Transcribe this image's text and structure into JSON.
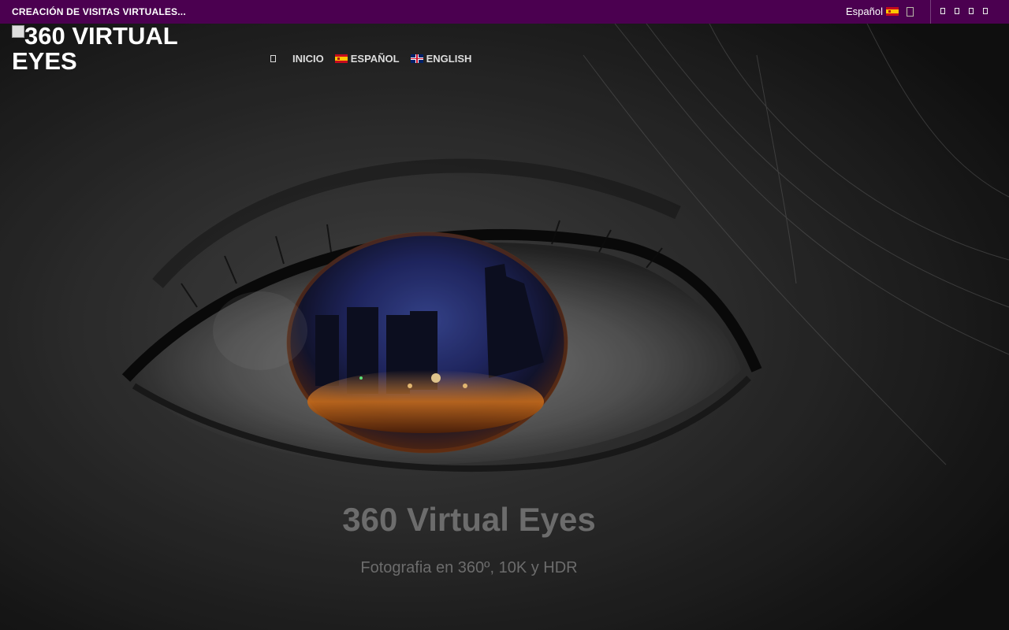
{
  "topbar": {
    "tagline": "CREACIÓN DE VISITAS VIRTUALES...",
    "language": "Español",
    "language_flag": "spain-flag-icon",
    "background_color": "#4b0050",
    "social_icons": [
      "social-icon-1",
      "social-icon-2",
      "social-icon-3",
      "social-icon-4"
    ]
  },
  "logo": {
    "alt_text": "360 VIRTUAL EYES"
  },
  "nav": {
    "home_icon": "home-icon",
    "items": [
      {
        "label": "INICIO"
      },
      {
        "label": "ESPAÑOL",
        "flag": "spain-flag-icon"
      },
      {
        "label": "ENGLISH",
        "flag": "uk-flag-icon"
      }
    ]
  },
  "hero": {
    "title": "360 Virtual Eyes",
    "subtitle": "Fotografia en 360º, 10K y HDR",
    "image": "eye-city-reflection"
  }
}
